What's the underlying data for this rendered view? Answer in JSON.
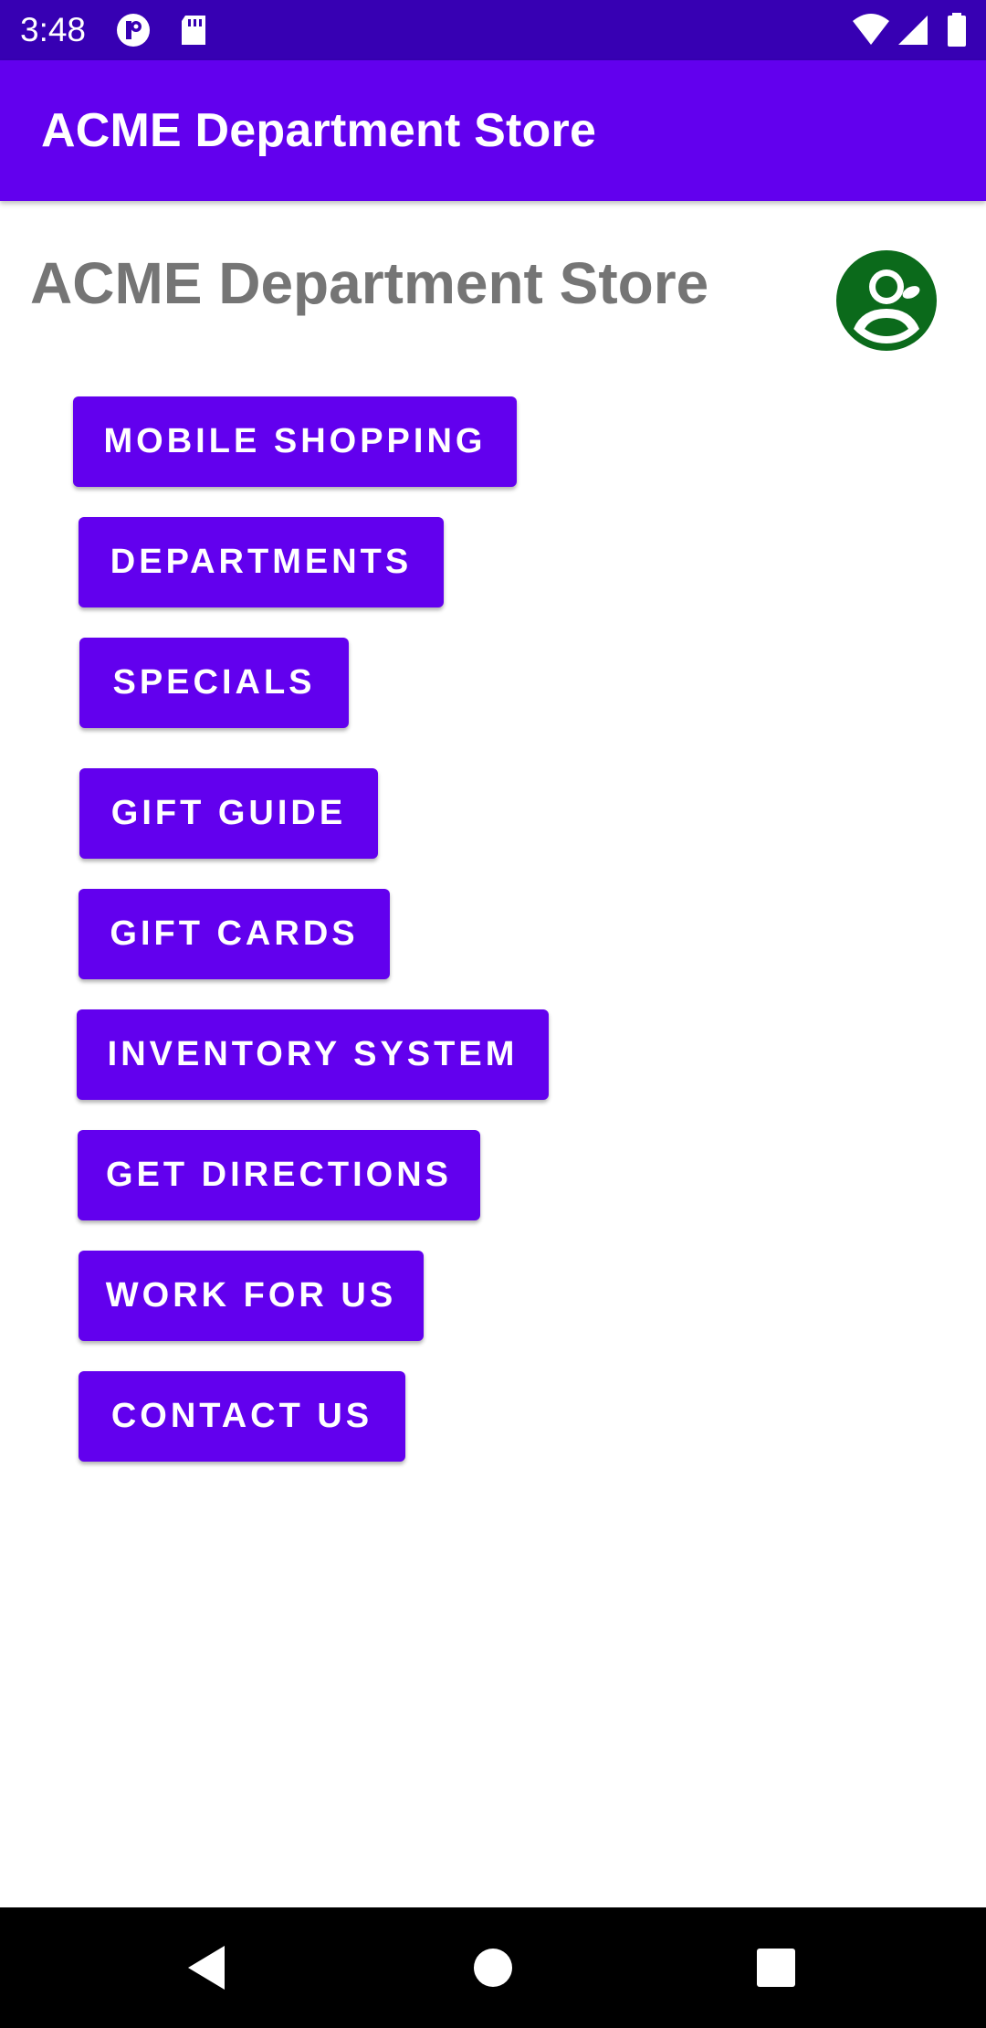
{
  "status_bar": {
    "time": "3:48",
    "icons": [
      "vpn-key-icon",
      "sd-card-icon",
      "wifi-icon",
      "cell-signal-icon",
      "battery-icon"
    ]
  },
  "app_bar": {
    "title": "ACME Department Store",
    "color": "#6200ee"
  },
  "main": {
    "heading": "ACME Department Store",
    "profile_icon": "account-circle-icon",
    "profile_color": "#0b6a1b",
    "buttons": [
      {
        "label": "MOBILE SHOPPING"
      },
      {
        "label": "DEPARTMENTS"
      },
      {
        "label": "SPECIALS"
      },
      {
        "label": "GIFT GUIDE"
      },
      {
        "label": "GIFT CARDS"
      },
      {
        "label": "INVENTORY SYSTEM"
      },
      {
        "label": "GET DIRECTIONS"
      },
      {
        "label": "WORK FOR US"
      },
      {
        "label": "CONTACT US"
      }
    ]
  },
  "nav_bar": {
    "icons": [
      "back-icon",
      "home-icon",
      "recents-icon"
    ]
  }
}
